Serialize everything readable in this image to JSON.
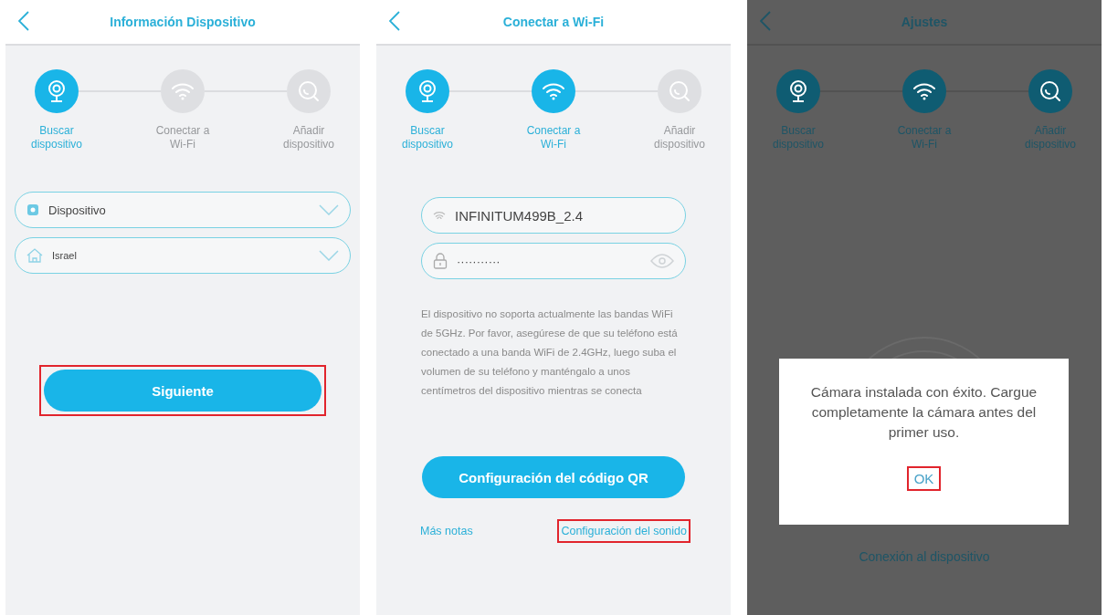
{
  "screens": [
    {
      "kind": "form",
      "dimmed": false,
      "title": "Información Dispositivo",
      "steps": [
        {
          "label": "Buscar dispositivo",
          "active": true
        },
        {
          "label": "Conectar a Wi-Fi",
          "active": false
        },
        {
          "label": "Añadir dispositivo",
          "active": false
        }
      ],
      "fields": [
        {
          "kind": "dropdown",
          "value": "Dispositivo"
        },
        {
          "kind": "dropdown",
          "value": "Israel"
        }
      ],
      "primary_button": {
        "label": "Siguiente",
        "highlighted": true
      }
    },
    {
      "kind": "wifi",
      "dimmed": false,
      "title": "Conectar a Wi-Fi",
      "steps": [
        {
          "label": "Buscar dispositivo",
          "active": true
        },
        {
          "label": "Conectar a Wi-Fi",
          "active": true
        },
        {
          "label": "Añadir dispositivo",
          "active": false
        }
      ],
      "fields": [
        {
          "kind": "text",
          "value": "INFINITUM499B_2.4"
        },
        {
          "kind": "password",
          "value": "···········"
        }
      ],
      "note": "El dispositivo no soporta actualmente las bandas WiFi de 5GHz. Por favor, asegúrese de que su teléfono está conectado a una banda WiFi de 2.4GHz, luego suba el volumen de su teléfono y manténgalo a unos centímetros del dispositivo mientras se conecta",
      "primary_button": {
        "label": "Configuración del código QR",
        "highlighted": false
      },
      "links": [
        {
          "label": "Más notas",
          "highlighted": false
        },
        {
          "label": "Configuración del sonido",
          "highlighted": true
        }
      ]
    },
    {
      "kind": "progress",
      "dimmed": true,
      "title": "Ajustes",
      "steps": [
        {
          "label": "Buscar dispositivo",
          "active": true
        },
        {
          "label": "Conectar a Wi-Fi",
          "active": true
        },
        {
          "label": "Añadir dispositivo",
          "active": true
        }
      ],
      "status": "Conexión al dispositivo",
      "dialog": {
        "message": "Cámara instalada con éxito. Cargue completamente la cámara antes del primer uso.",
        "button": {
          "label": "OK",
          "highlighted": true
        }
      }
    }
  ]
}
